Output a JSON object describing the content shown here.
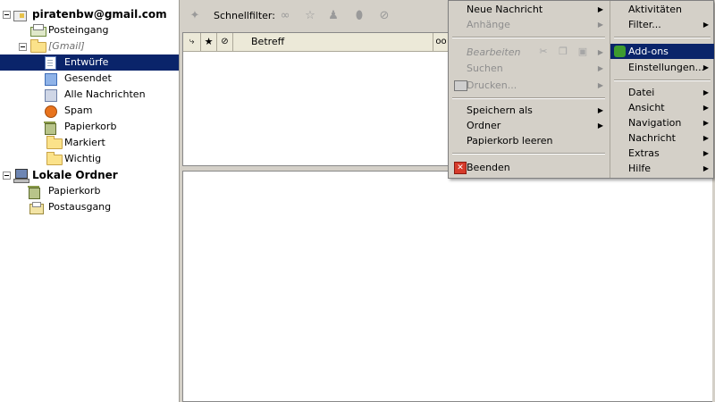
{
  "folder_tree": {
    "account": "piratenbw@gmail.com",
    "inbox": "Posteingang",
    "gmail_group": "[Gmail]",
    "gmail_folders": [
      "Entwürfe",
      "Gesendet",
      "Alle Nachrichten",
      "Spam",
      "Papierkorb",
      "Markiert",
      "Wichtig"
    ],
    "selected_folder": "Entwürfe",
    "local_account": "Lokale Ordner",
    "local_folders": [
      "Papierkorb",
      "Postausgang"
    ]
  },
  "toolbar": {
    "quick_filter_label": "Schnellfilter:",
    "icons": [
      "pin-icon",
      "unread-glasses-icon",
      "star-icon",
      "contact-icon",
      "tag-icon",
      "attachment-icon"
    ]
  },
  "thread_columns": {
    "betreff": "Betreff"
  },
  "app_menu": {
    "left": {
      "new_message": "Neue Nachricht",
      "attachments": "Anhänge",
      "edit": "Bearbeiten",
      "search": "Suchen",
      "print": "Drucken...",
      "save_as": "Speichern als",
      "folder": "Ordner",
      "empty_trash": "Papierkorb leeren",
      "quit": "Beenden"
    },
    "right": {
      "activities": "Aktivitäten",
      "filters": "Filter...",
      "addons": "Add-ons",
      "settings": "Einstellungen...",
      "file": "Datei",
      "view": "Ansicht",
      "navigation": "Navigation",
      "message": "Nachricht",
      "extras": "Extras",
      "help": "Hilfe"
    }
  },
  "colors": {
    "selection": "#0a246a",
    "chrome": "#d4d0c8"
  }
}
